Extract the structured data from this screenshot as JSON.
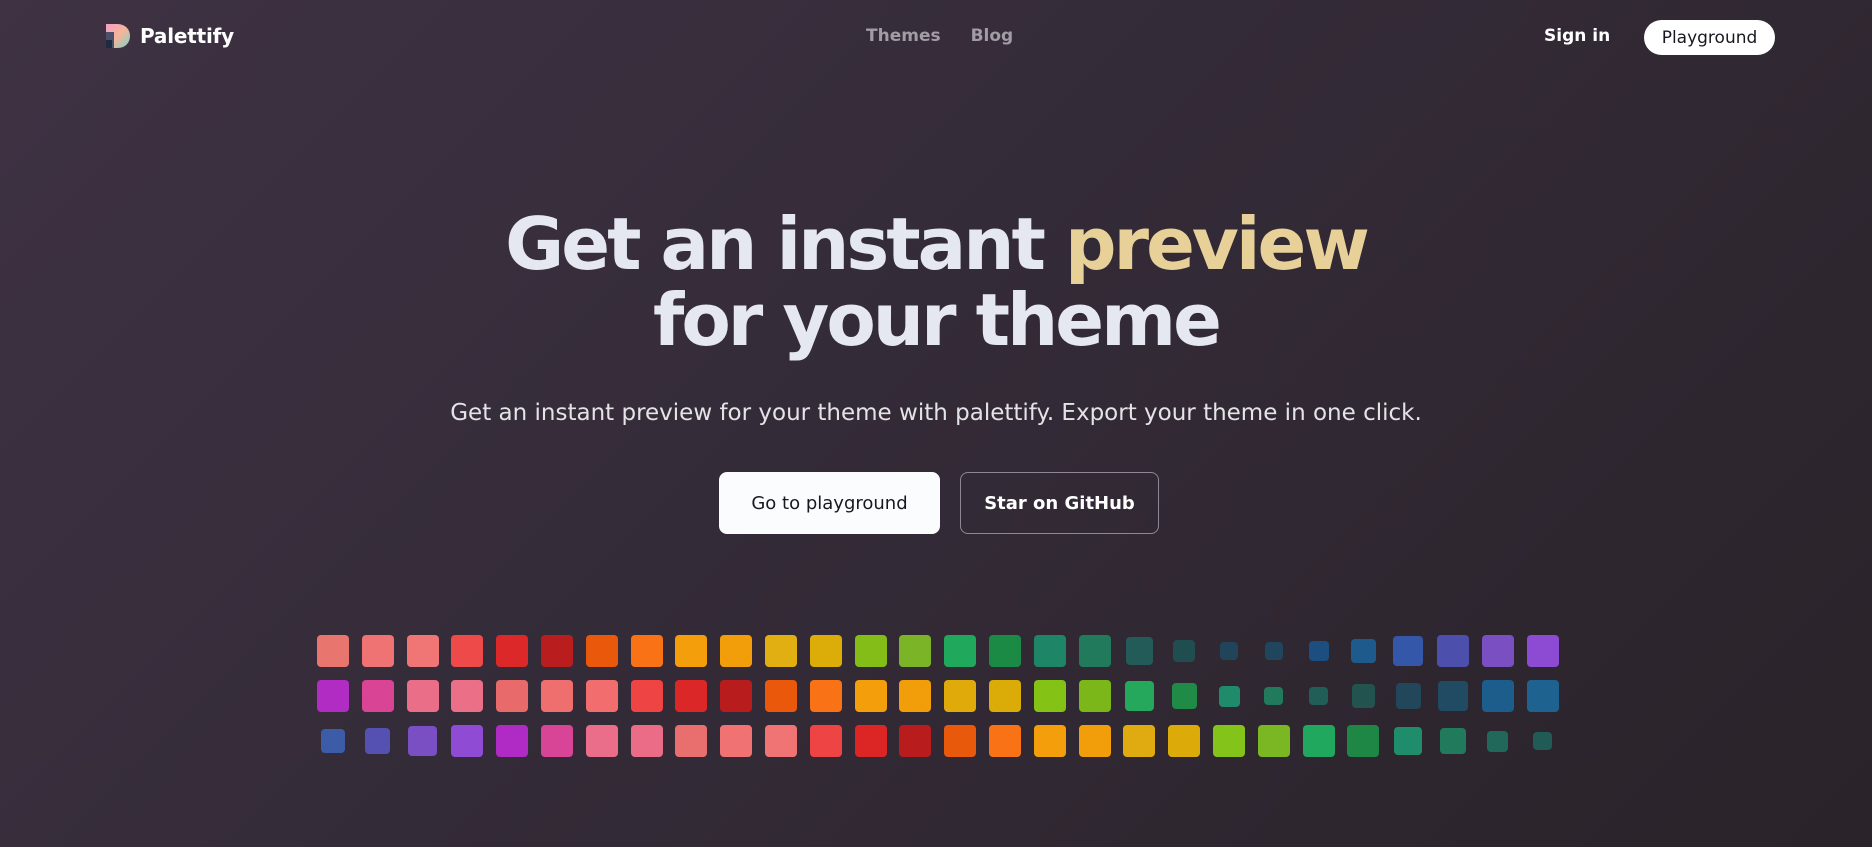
{
  "nav": {
    "brand_name": "Palettify",
    "links": [
      "Themes",
      "Blog"
    ],
    "sign_in": "Sign in",
    "playground": "Playground"
  },
  "hero": {
    "title_line1_prefix": "Get an instant ",
    "title_line1_accent": "preview",
    "title_line2": "for your theme",
    "subtitle": "Get an instant preview for your theme with palettify. Export your theme in one click.",
    "cta_primary": "Go to playground",
    "cta_secondary": "Star on GitHub"
  },
  "colors": {
    "background_start": "#3e3243",
    "background_end": "#2a2329",
    "accent": "#e8d199",
    "title_text": "#e5e8f0"
  },
  "swatch_rows": [
    {
      "colors": [
        "#e9756f",
        "#ef7372",
        "#f07575",
        "#ef4a4a",
        "#dc2828",
        "#b91d1d",
        "#ea580c",
        "#f97316",
        "#f59e0b",
        "#f29e0b",
        "#e2af12",
        "#dcac08",
        "#84bd18",
        "#7bb527",
        "#20a85c",
        "#1b8a45",
        "#1e8566",
        "#217a5c",
        "#225b58",
        "#204e50",
        "#20445a",
        "#1f465c",
        "#1d4e80",
        "#1e5b8c",
        "#3557a9",
        "#4c4fab",
        "#7a4fc2",
        "#8c4bd2"
      ]
    },
    {
      "colors": [
        "#b02cc2",
        "#d94594",
        "#ea6e87",
        "#ea6f87",
        "#e86a6a",
        "#ef6e6e",
        "#f26d6d",
        "#ef4444",
        "#db2727",
        "#b91c1c",
        "#ea580c",
        "#f97316",
        "#f59e0b",
        "#f29e0b",
        "#dfaa0a",
        "#dbab08",
        "#84c316",
        "#7cb71a",
        "#26a85c",
        "#1f8b46",
        "#1f8b6b",
        "#217a5c",
        "#225e58",
        "#22534f",
        "#22475a",
        "#204b62",
        "#1c5d8b",
        "#1e638f"
      ]
    },
    {
      "colors": [
        "#3c5ca8",
        "#5451b3",
        "#7a4fc4",
        "#8f4bd4",
        "#b02bc6",
        "#d84496",
        "#ea6e8a",
        "#ea6c86",
        "#e96e6e",
        "#f07272",
        "#f17474",
        "#ef4444",
        "#dc2626",
        "#b91c1c",
        "#e8590c",
        "#f97316",
        "#f59e0b",
        "#f29e0b",
        "#e0ab10",
        "#dcab0a",
        "#84c31a",
        "#7bb723",
        "#1fa85e",
        "#1e8746",
        "#1f8d69",
        "#217a5c",
        "#21685a",
        "#205b55"
      ]
    }
  ]
}
